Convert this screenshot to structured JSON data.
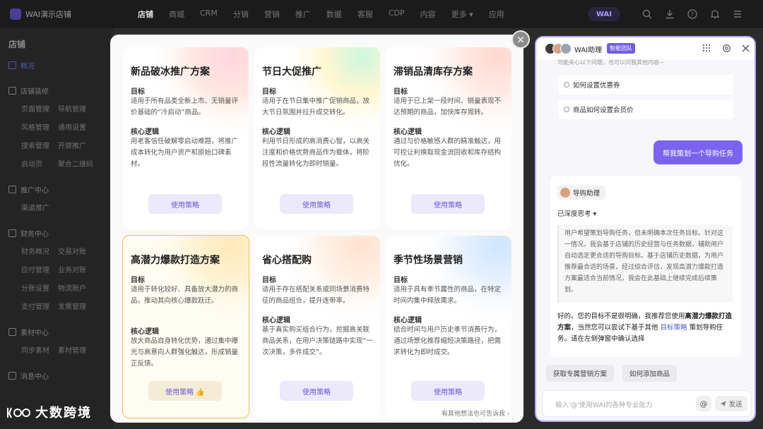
{
  "app": {
    "name": "WAI演示店铺"
  },
  "nav": {
    "items": [
      "店铺",
      "商城",
      "CRM",
      "分销",
      "营销",
      "推广",
      "数据",
      "客服",
      "CDP",
      "内容",
      "更多 ▾",
      "应用"
    ],
    "logo": "WAI"
  },
  "sidebar": {
    "title": "店铺",
    "overview": "概况",
    "sections": [
      {
        "title": "店铺装修",
        "rows": [
          [
            "页面管理",
            "导航管理"
          ],
          [
            "风格管理",
            "通用设置"
          ],
          [
            "搜索管理",
            "开屏推广"
          ],
          [
            "启动页",
            "聚合二维码"
          ]
        ]
      },
      {
        "title": "推广中心",
        "rows": [
          [
            "渠道推广",
            ""
          ]
        ]
      },
      {
        "title": "财务中心",
        "rows": [
          [
            "财务概况",
            "交易对账"
          ],
          [
            "应付管理",
            "业务对账"
          ],
          [
            "分账设置",
            "物流账户"
          ],
          [
            "支付管理",
            "发票管理"
          ]
        ]
      },
      {
        "title": "素材中心",
        "rows": [
          [
            "同步素材",
            "素材管理"
          ]
        ]
      },
      {
        "title": "消息中心",
        "rows": []
      }
    ]
  },
  "modal": {
    "goal_label": "目标",
    "logic_label": "核心逻辑",
    "cards": [
      {
        "title": "新品破冰推广方案",
        "goal": "适用于所有品类全新上市、无销量评价基础的“冷启动”商品。",
        "logic": "用老客信任破解零启动难题，将推广成本转化为用户资产和原始口碑素材。",
        "button": "使用策略"
      },
      {
        "title": "节日大促推广",
        "goal": "适用于在节日集中推广促销商品，放大节日氛围并拉升成交转化。",
        "logic": "利用节日形成的高消费心智，以高关注度和价格优势商品作为载体，将阶段性流量转化为即时销量。",
        "button": "使用策略"
      },
      {
        "title": "滞销品清库存方案",
        "goal": "适用于已上架一段时间、销量表现不达预期的商品，加快库存周转。",
        "logic": "通过与价格敏感人群的精准触达，用可控让利换取现金流回收和库存结构优化。",
        "button": "使用策略"
      },
      {
        "title": "高潜力爆款打造方案",
        "goal": "适用于转化较好、具备放大潜力的商品，推动其向核心爆款跃迁。",
        "logic": "放大商品自身转化优势，通过集中曝光与高意向人群强化触达，形成销量正反馈。",
        "button": "使用策略 👍"
      },
      {
        "title": "省心搭配购",
        "goal": "适用于存在搭配关系或同场景消费特征的商品组合，提升连带率。",
        "logic": "基于真实购买组合行为，挖掘高关联商品关系，在用户决策链路中实现“一次决策，多件成交”。",
        "button": "使用策略"
      },
      {
        "title": "季节性场景营销",
        "goal": "适用于具有季节属性的商品，在特定时间内集中释放需求。",
        "logic": "结合时间与用户历史季节消费行为，通过场景化推荐缩短决策路径，把需求转化为即时成交。",
        "button": "使用策略"
      }
    ],
    "footer": "有其他想法也可告诉我 ›"
  },
  "panel": {
    "name": "WAI助理",
    "badge": "智能团队",
    "cut_text": "可能关心以下问题，也可以问我其他内容~",
    "suggestions": [
      "如何设置优惠券",
      "商品如何设置会员价"
    ],
    "user_message": "帮我策划一个导购任务",
    "agent_name": "导购助理",
    "thinking_label": "已深度思考",
    "thinking_text": "用户希望策划导购任务，但未明确本次任务目标。针对这一情况，我会基于店铺的历史经营与任务数据，辅助用户自动选定更合适的导购目标。基于店铺历史数据，为用户推荐最合适的场景，经过综合评估，发现高潜力爆款打造方案最适合当前情况，我会在此基础上继续完成后续策划。",
    "answer_parts": {
      "p1": "好的。您的目标不是很明确，我推荐您使用",
      "highlight": "高潜力爆款打造方案",
      "p2": "，当然您可以尝试下基于其他",
      "link": "目标策略",
      "p3": "策划导购任务。请在左侧弹窗中确认选择"
    },
    "chips": [
      "获取专属营销方案",
      "如何添加商品"
    ],
    "input_placeholder": "输入'@'使用WAI的各种专业能力",
    "send_label": "发送"
  },
  "watermark": "大数跨境",
  "colors": {
    "accent": "#7b63f0",
    "highlight_border": "#f2c14a",
    "button_bg": "#ece9fb"
  }
}
